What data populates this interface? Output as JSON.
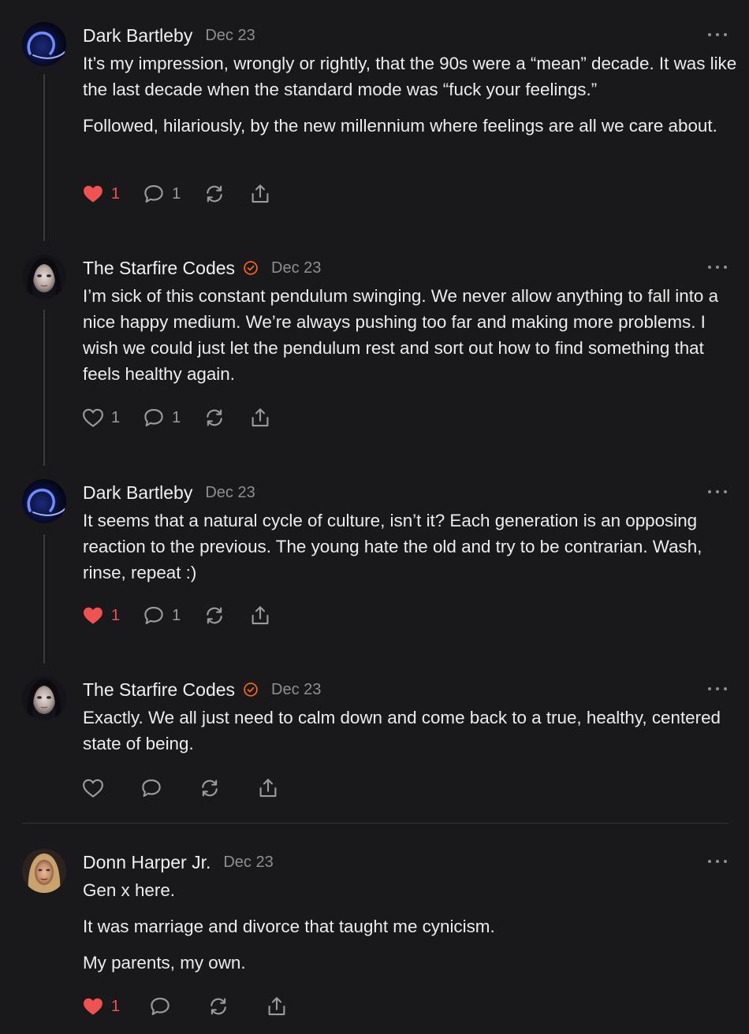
{
  "comments": [
    {
      "author": "Dark Bartleby",
      "date": "Dec 23",
      "verified": false,
      "avatar": "blue-arc-avatar",
      "paragraphs": [
        "It’s my impression, wrongly or rightly, that the 90s were a “mean” decade. It was like the last decade when the standard mode was “fuck your feelings.”",
        "Followed, hilariously, by the new millennium where feelings are all we care about."
      ],
      "likes": "1",
      "liked": true,
      "replies": "1"
    },
    {
      "author": "The Starfire Codes",
      "date": "Dec 23",
      "verified": true,
      "avatar": "dark-hair-portrait-avatar",
      "paragraphs": [
        "I’m sick of this constant pendulum swinging. We never allow anything to fall into a nice happy medium. We’re always pushing too far and making more problems. I wish we could just let the pendulum rest and sort out how to find something that feels healthy again."
      ],
      "likes": "1",
      "liked": false,
      "replies": "1"
    },
    {
      "author": "Dark Bartleby",
      "date": "Dec 23",
      "verified": false,
      "avatar": "blue-arc-avatar",
      "paragraphs": [
        "It seems that a natural cycle of culture, isn’t it? Each generation is an opposing reaction to the previous. The young hate the old and try to be contrarian. Wash, rinse, repeat :)"
      ],
      "likes": "1",
      "liked": true,
      "replies": "1"
    },
    {
      "author": "The Starfire Codes",
      "date": "Dec 23",
      "verified": true,
      "avatar": "dark-hair-portrait-avatar",
      "paragraphs": [
        "Exactly. We all just need to calm down and come back to a true, healthy, centered state of being."
      ],
      "likes": "",
      "liked": false,
      "replies": ""
    },
    {
      "author": "Donn Harper Jr.",
      "date": "Dec 23",
      "verified": false,
      "avatar": "blond-portrait-avatar",
      "paragraphs": [
        "Gen x here.",
        "It was marriage and divorce that taught me cynicism.",
        "My parents, my own."
      ],
      "likes": "1",
      "liked": true,
      "replies": ""
    }
  ],
  "icons": {
    "like": "heart-icon",
    "reply": "speech-bubble-icon",
    "restack": "restack-arrows-icon",
    "share": "share-icon",
    "more": "more-dots-icon",
    "verified": "verified-check-icon"
  },
  "colors": {
    "background": "#19191b",
    "liked_heart": "#f05252",
    "verified_badge": "#ff6719",
    "muted_text": "#8e8e93"
  }
}
